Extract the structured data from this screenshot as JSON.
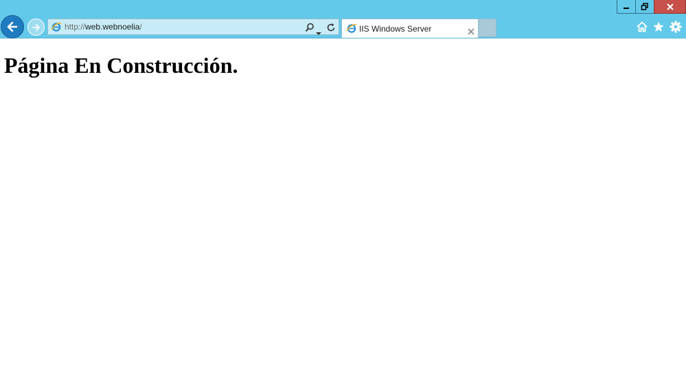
{
  "browser": {
    "address": {
      "scheme": "http://",
      "host": "web.webnoelia",
      "path": "/"
    },
    "tab": {
      "title": "IIS Windows Server"
    },
    "icons": {
      "back": "back-arrow-icon",
      "forward": "forward-arrow-icon",
      "site": "ie-logo-icon",
      "search": "search-icon",
      "dropdown": "chevron-down-icon",
      "refresh": "refresh-icon",
      "tab_close": "close-icon",
      "home": "home-icon",
      "favorites": "star-icon",
      "tools": "gear-icon",
      "minimize": "minimize-icon",
      "restore": "restore-icon",
      "close": "close-icon"
    },
    "colors": {
      "frame": "#63c9ea",
      "back_button": "#1f7bbf",
      "close_button": "#c7504a",
      "address_bg": "#c7ecf7"
    }
  },
  "page": {
    "heading": "Página En Construcción."
  }
}
